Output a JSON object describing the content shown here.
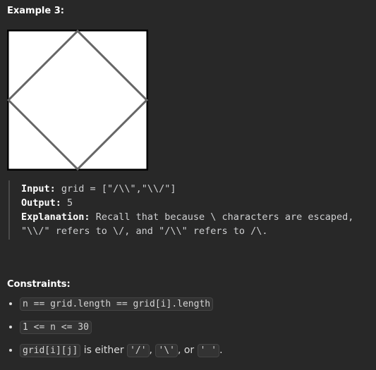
{
  "example_title": "Example 3:",
  "figure": {
    "icon": "grid-diamond-image"
  },
  "example": {
    "input_label": "Input:",
    "input_value": "grid = [\"/\\\\\",\"\\\\/\"]",
    "output_label": "Output:",
    "output_value": "5",
    "explanation_label": "Explanation:",
    "explanation_line1": "Recall that because \\ characters are escaped,",
    "explanation_line2": "\"\\\\/\" refers to \\/, and \"/\\\\\" refers to /\\."
  },
  "constraints_title": "Constraints:",
  "constraints": [
    {
      "code": "n == grid.length == grid[i].length"
    },
    {
      "code": "1 <= n <= 30"
    },
    {
      "code": "grid[i][j]",
      "text1": " is either ",
      "c2": "'/'",
      "t2": ", ",
      "c3": "'\\'",
      "t3": ", or ",
      "c4": "' '",
      "t4": "."
    }
  ]
}
